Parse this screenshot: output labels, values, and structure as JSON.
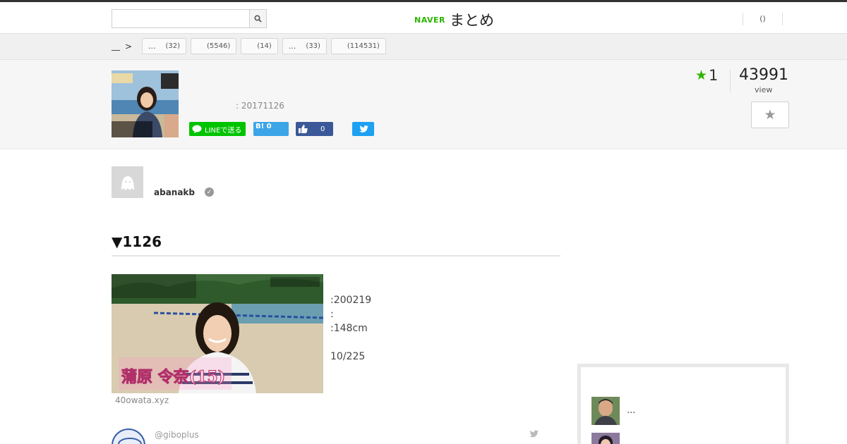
{
  "header": {
    "search": {
      "value": "",
      "placeholder": ""
    },
    "logo": {
      "naver": "NAVER",
      "matome": "まとめ"
    },
    "user_menu": "()"
  },
  "categories": {
    "home_label": "__",
    "tags": [
      {
        "label": "...",
        "count": "(32)"
      },
      {
        "label": "",
        "count": "(5546)"
      },
      {
        "label": "",
        "count": "(14)"
      },
      {
        "label": "...",
        "count": "(33)"
      },
      {
        "label": "",
        "count": "(114531)"
      }
    ]
  },
  "article": {
    "date": ": 20171126",
    "share": {
      "line": "LINEで送る",
      "hatena": "B!",
      "hatena_count": "0",
      "facebook_count": "0"
    },
    "favorites": "1",
    "views": "43991",
    "views_label": "view"
  },
  "author": {
    "name": "abanakb"
  },
  "content": {
    "heading": "▼1126",
    "source": "40owata.xyz",
    "profile": [
      ":200219",
      ":",
      ":148cm",
      "",
      "10/225"
    ],
    "tweet": {
      "handle": "@giboplus"
    }
  },
  "sidebar": {
    "items": [
      {
        "title": "..."
      },
      {
        "title": ""
      }
    ]
  },
  "colors": {
    "brand_green": "#2db400",
    "line_green": "#00c300",
    "hatena_blue": "#3ca5e8",
    "facebook_blue": "#3b5998",
    "twitter_blue": "#1da1f2"
  }
}
